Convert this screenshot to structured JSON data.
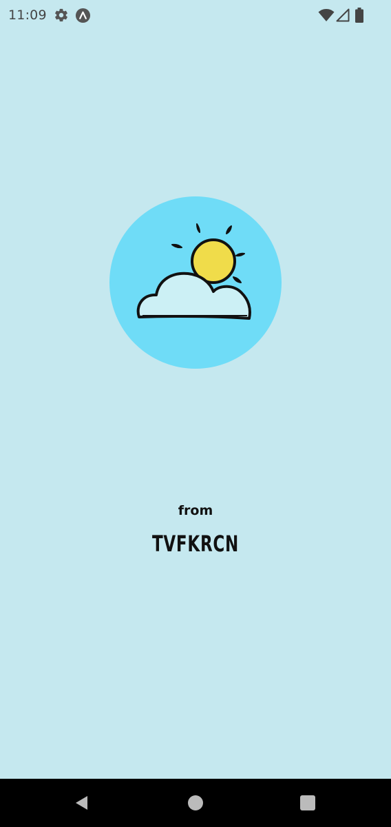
{
  "status_bar": {
    "time": "11:09",
    "icons": [
      "gear-icon",
      "app-badge-icon",
      "wifi-icon",
      "signal-icon",
      "battery-icon"
    ]
  },
  "splash": {
    "logo_icon": "weather-sun-cloud-icon",
    "from_label": "from",
    "brand": "TVFKRCN"
  },
  "nav_bar": {
    "buttons": [
      "back",
      "home",
      "recents"
    ]
  },
  "colors": {
    "background": "#c5e8ef",
    "logo_circle": "#6fdcf7",
    "sun": "#f0dc4a",
    "cloud": "#ccf0f5"
  }
}
